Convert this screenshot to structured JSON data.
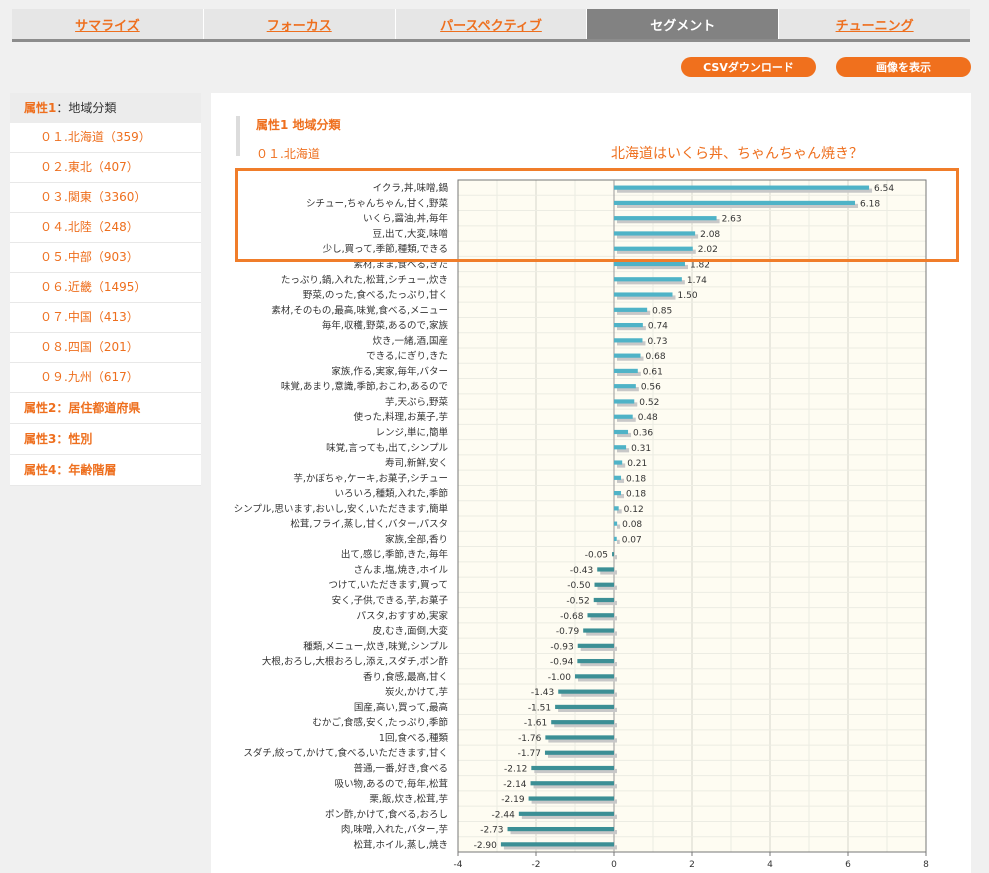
{
  "tabs": [
    {
      "label": "サマライズ",
      "active": false
    },
    {
      "label": "フォーカス",
      "active": false
    },
    {
      "label": "パースペクティブ",
      "active": false
    },
    {
      "label": "セグメント",
      "active": true
    },
    {
      "label": "チューニング",
      "active": false
    }
  ],
  "buttons": {
    "csv": "CSVダウンロード",
    "image": "画像を表示"
  },
  "sidebar": {
    "attr1_label": "属性1",
    "attr1_value": "：地域分類",
    "items": [
      "０１.北海道（359）",
      "０２.東北（407）",
      "０３.関東（3360）",
      "０４.北陸（248）",
      "０５.中部（903）",
      "０６.近畿（1495）",
      "０７.中国（413）",
      "０８.四国（201）",
      "０９.九州（617）"
    ],
    "attrs": [
      "属性2：居住都道府県",
      "属性3：性別",
      "属性4：年齢階層"
    ]
  },
  "heading": {
    "title": "属性1 地域分類",
    "subtitle": "０１.北海道"
  },
  "annotation": "北海道はいくら丼、ちゃんちゃん焼き？",
  "colors": {
    "accent": "#ee6f1e",
    "bar_pos": "#4fb3c7",
    "bar_neg": "#3c8f95",
    "shadow": "#c8c8c8",
    "plot_bg": "#fefcf2"
  },
  "chart_data": {
    "type": "bar",
    "orientation": "horizontal",
    "xlim": [
      -4,
      8
    ],
    "xticks": [
      -4,
      -2,
      0,
      2,
      4,
      6,
      8
    ],
    "grid": true,
    "categories": [
      "イクラ,丼,味噌,鍋",
      "シチュー,ちゃんちゃん,甘く,野菜",
      "いくら,醤油,丼,毎年",
      "豆,出て,大変,味噌",
      "少し,買って,季節,種類,できる",
      "素材,まま,食べる,きた",
      "たっぷり,鍋,入れた,松茸,シチュー,炊き",
      "野菜,のった,食べる,たっぷり,甘く",
      "素材,そのもの,最高,味覚,食べる,メニュー",
      "毎年,収穫,野菜,あるので,家族",
      "炊き,一緒,酒,国産",
      "できる,にぎり,きた",
      "家族,作る,実家,毎年,バター",
      "味覚,あまり,意識,季節,おこわ,あるので",
      "芋,天ぷら,野菜",
      "使った,料理,お菓子,芋",
      "レンジ,単に,簡単",
      "味覚,言っても,出て,シンプル",
      "寿司,新鮮,安く",
      "芋,かぼちゃ,ケーキ,お菓子,シチュー",
      "いろいろ,種類,入れた,季節",
      "シンプル,思います,おいし,安く,いただきます,簡単",
      "松茸,フライ,蒸し,甘く,バター,パスタ",
      "家族,全部,香り",
      "出て,感じ,季節,きた,毎年",
      "さんま,塩,焼き,ホイル",
      "つけて,いただきます,買って",
      "安く,子供,できる,芋,お菓子",
      "パスタ,おすすめ,実家",
      "皮,むき,面倒,大変",
      "種類,メニュー,炊き,味覚,シンプル",
      "大根,おろし,大根おろし,添え,スダチ,ポン酢",
      "香り,食感,最高,甘く",
      "炭火,かけて,芋",
      "国産,高い,買って,最高",
      "むかご,食感,安く,たっぷり,季節",
      "1回,食べる,種類",
      "スダチ,絞って,かけて,食べる,いただきます,甘く",
      "普通,一番,好き,食べる",
      "吸い物,あるので,毎年,松茸",
      "栗,飯,炊き,松茸,芋",
      "ポン酢,かけて,食べる,おろし",
      "肉,味噌,入れた,バター,芋",
      "松茸,ホイル,蒸し,焼き"
    ],
    "values": [
      6.54,
      6.18,
      2.63,
      2.08,
      2.02,
      1.82,
      1.74,
      1.5,
      0.85,
      0.74,
      0.73,
      0.68,
      0.61,
      0.56,
      0.52,
      0.48,
      0.36,
      0.31,
      0.21,
      0.18,
      0.18,
      0.12,
      0.08,
      0.07,
      -0.05,
      -0.43,
      -0.5,
      -0.52,
      -0.68,
      -0.79,
      -0.93,
      -0.94,
      -1.0,
      -1.43,
      -1.51,
      -1.61,
      -1.76,
      -1.77,
      -2.12,
      -2.14,
      -2.19,
      -2.44,
      -2.73,
      -2.9
    ],
    "value_labels": [
      "6.54",
      "6.18",
      "2.63",
      "2.08",
      "2.02",
      "1.82",
      "1.74",
      "1.50",
      "0.85",
      "0.74",
      "0.73",
      "0.68",
      "0.61",
      "0.56",
      "0.52",
      "0.48",
      "0.36",
      "0.31",
      "0.21",
      "0.18",
      "0.18",
      "0.12",
      "0.08",
      "0.07",
      "-0.05",
      "-0.43",
      "-0.50",
      "-0.52",
      "-0.68",
      "-0.79",
      "-0.93",
      "-0.94",
      "-1.00",
      "-1.43",
      "-1.51",
      "-1.61",
      "-1.76",
      "-1.77",
      "-2.12",
      "-2.14",
      "-2.19",
      "-2.44",
      "-2.73",
      "-2.90"
    ]
  }
}
